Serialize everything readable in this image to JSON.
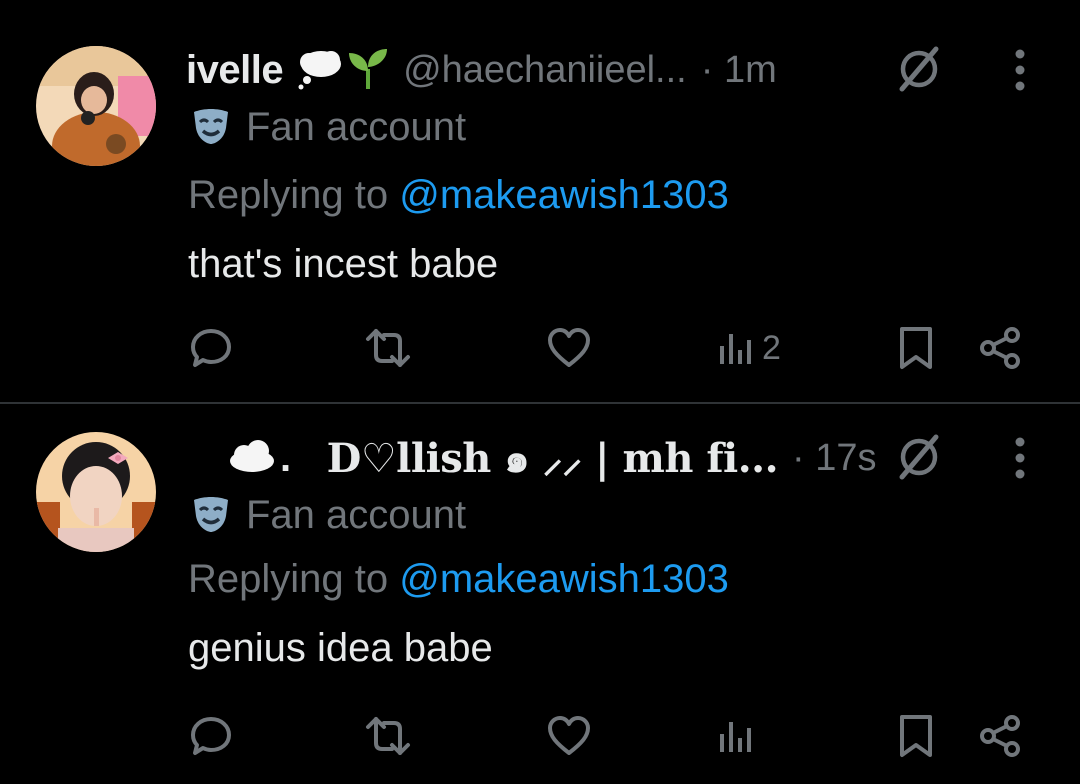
{
  "colors": {
    "background": "#000000",
    "text_primary": "#e7e9ea",
    "text_secondary": "#71767b",
    "link": "#1d9bf0",
    "separator": "#2f3336"
  },
  "tweets": [
    {
      "avatar_icon": "user-avatar",
      "display_name": "ivelle",
      "name_emojis": [
        "thought-balloon-emoji",
        "seedling-emoji"
      ],
      "handle": "@haechaniieel...",
      "time": "· 1m",
      "label": "Fan account",
      "replying_prefix": "Replying to ",
      "replying_to": "@makeawish1303",
      "text": "that's incest babe",
      "views": "2"
    },
    {
      "avatar_icon": "user-avatar",
      "display_name_lead": "☁️.",
      "display_name": "D♡llish ๑ ⸝⸝ | mh fi...",
      "time": "· 17s",
      "label": "Fan account",
      "replying_prefix": "Replying to ",
      "replying_to": "@makeawish1303",
      "text": "genius idea babe",
      "views": ""
    }
  ]
}
